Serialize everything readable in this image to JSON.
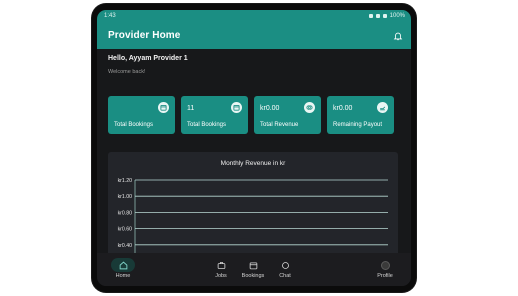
{
  "status_bar": {
    "time": "1:43",
    "battery": "100%"
  },
  "app_bar": {
    "title": "Provider Home"
  },
  "greeting": {
    "title": "Hello, Ayyam Provider 1",
    "subtitle": "Welcome back!"
  },
  "stats": [
    {
      "value": "",
      "label": "Total Bookings",
      "icon": "calendar-icon"
    },
    {
      "value": "11",
      "label": "Total Bookings",
      "icon": "calendar-icon"
    },
    {
      "value": "kr0.00",
      "label": "Total Revenue",
      "icon": "coins-icon"
    },
    {
      "value": "kr0.00",
      "label": "Remaining Payout",
      "icon": "payout-icon"
    }
  ],
  "chart_data": {
    "type": "line",
    "title": "Monthly Revenue in kr",
    "y_ticks": [
      "kr1.20",
      "kr1.00",
      "kr0.80",
      "kr0.60",
      "kr0.40"
    ],
    "ylim": [
      0.4,
      1.2
    ],
    "series": [],
    "grid": true
  },
  "bottom_nav": [
    {
      "label": "Home",
      "icon": "home-icon",
      "active": true
    },
    {
      "label": "Jobs",
      "icon": "briefcase-icon"
    },
    {
      "label": "Bookings",
      "icon": "calendar-icon"
    },
    {
      "label": "Chat",
      "icon": "chat-icon"
    },
    {
      "label": "Profile",
      "icon": "avatar"
    }
  ],
  "colors": {
    "accent": "#1b8e83",
    "background": "#17181a",
    "panel": "#23252a"
  }
}
